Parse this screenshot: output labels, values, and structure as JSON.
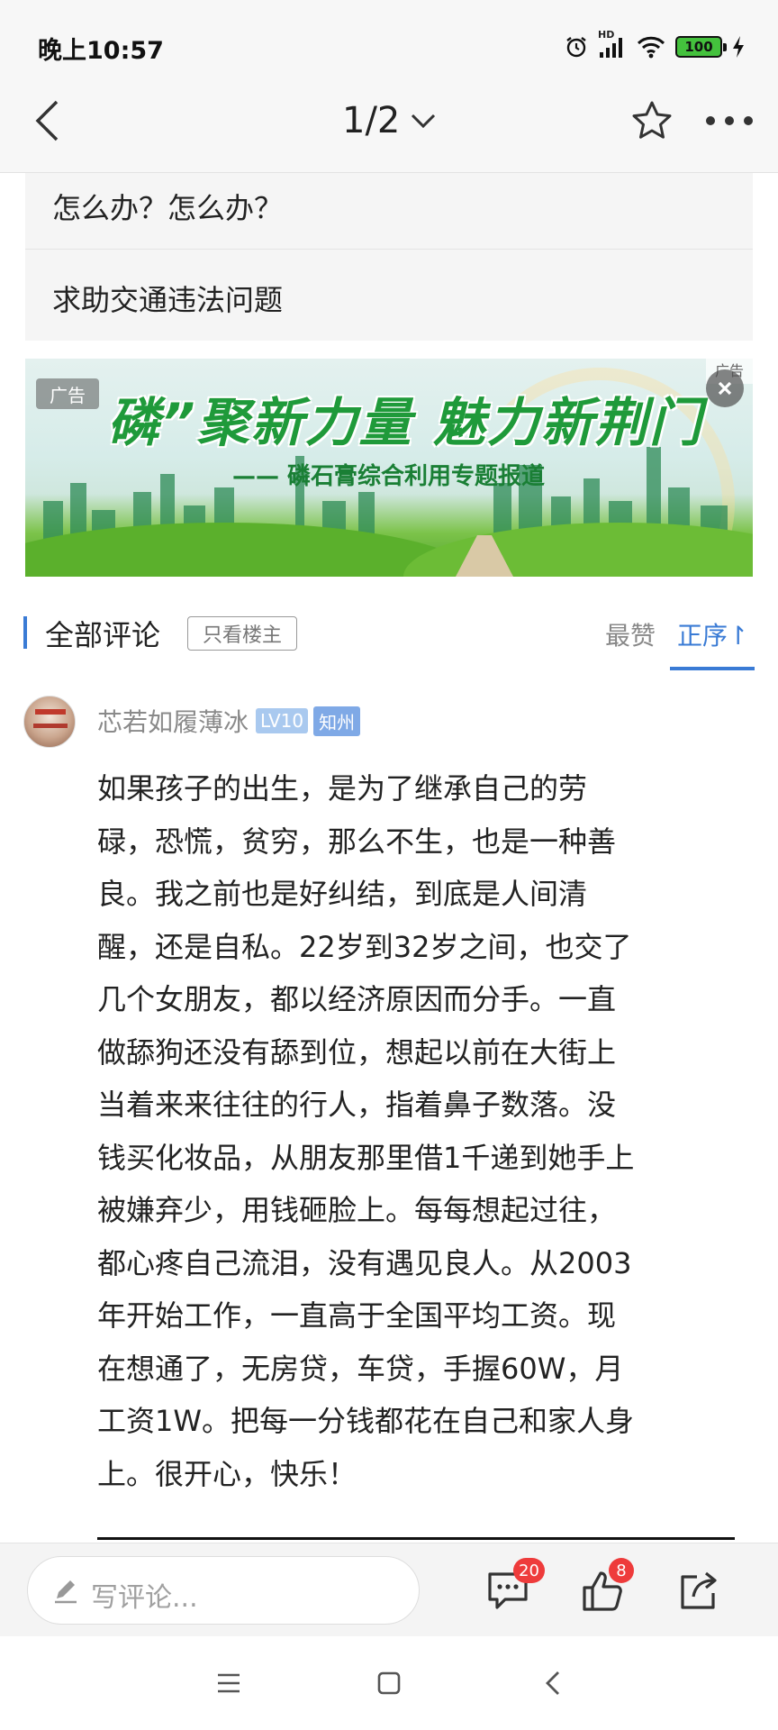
{
  "status_bar": {
    "time": "晚上10:57",
    "network_label": "HD",
    "battery_level": "100"
  },
  "top_nav": {
    "page_indicator": "1/2"
  },
  "related_posts": [
    {
      "title": "怎么办？怎么办？"
    },
    {
      "title": "求助交通违法问题"
    }
  ],
  "ad": {
    "badge": "广告",
    "corner_label": "广告",
    "headline": "磷”聚新力量 魅力新荆门",
    "subline": "—— 磷石膏综合利用专题报道"
  },
  "comments_header": {
    "title": "全部评论",
    "owner_only": "只看楼主",
    "sort_most_liked": "最赞",
    "sort_sequence": "正序↾"
  },
  "comment": {
    "username": "芯若如履薄冰",
    "level": "LV10",
    "location": "知州",
    "text": "如果孩子的出生，是为了继承自己的劳\n碌，恐慌，贫穷，那么不生，也是一种善\n良。我之前也是好纠结，到底是人间清\n醒，还是自私。22岁到32岁之间，也交了\n几个女朋友，都以经济原因而分手。一直\n做舔狗还没有舔到位，想起以前在大街上\n当着来来往往的行人，指着鼻子数落。没\n钱买化妆品，从朋友那里借1千递到她手上\n被嫌弃少，用钱砸脸上。每每想起过往，\n都心疼自己流泪，没有遇见良人。从2003\n年开始工作，一直高于全国平均工资。现\n在想通了，无房贷，车贷，手握60W，月\n工资1W。把每一分钱都花在自己和家人身\n上。很开心，快乐！"
  },
  "action_bar": {
    "write_placeholder": "写评论...",
    "comment_count": "20",
    "like_count": "8"
  },
  "colors": {
    "accent": "#3a7bd5",
    "badge_red": "#ee3b3b",
    "ad_green": "#1f9a3a"
  },
  "icons": {
    "back": "chevron-left-icon",
    "dropdown": "chevron-down-icon",
    "favorite": "star-icon",
    "more": "more-dots-icon",
    "close": "close-icon",
    "write": "pencil-icon",
    "comments": "comment-bubble-icon",
    "like": "thumbs-up-icon",
    "share": "share-icon"
  }
}
